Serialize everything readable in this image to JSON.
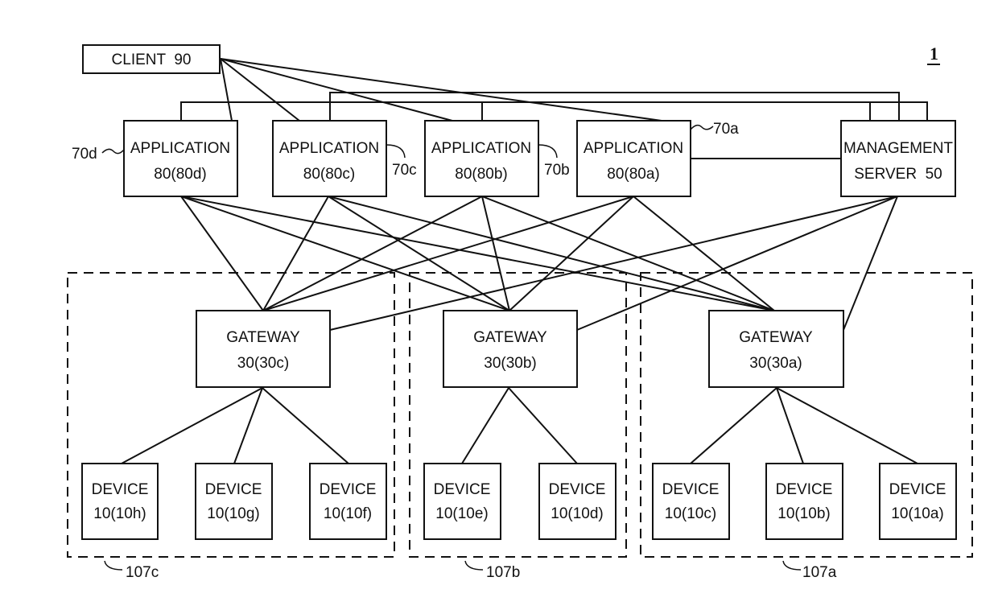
{
  "figure": {
    "number": "1"
  },
  "client": {
    "id": "client-90",
    "label": "CLIENT  90"
  },
  "applications": [
    {
      "id": "app-80d",
      "line1": "APPLICATION",
      "line2": "80(80d)",
      "ref": "70d"
    },
    {
      "id": "app-80c",
      "line1": "APPLICATION",
      "line2": "80(80c)",
      "ref": "70c"
    },
    {
      "id": "app-80b",
      "line1": "APPLICATION",
      "line2": "80(80b)",
      "ref": "70b"
    },
    {
      "id": "app-80a",
      "line1": "APPLICATION",
      "line2": "80(80a)",
      "ref": "70a"
    }
  ],
  "management_server": {
    "id": "mgmt-50",
    "line1": "MANAGEMENT",
    "line2": "SERVER  50"
  },
  "gateways": [
    {
      "id": "gw-30c",
      "line1": "GATEWAY",
      "line2": "30(30c)"
    },
    {
      "id": "gw-30b",
      "line1": "GATEWAY",
      "line2": "30(30b)"
    },
    {
      "id": "gw-30a",
      "line1": "GATEWAY",
      "line2": "30(30a)"
    }
  ],
  "devices": [
    {
      "id": "dev-10h",
      "line1": "DEVICE",
      "line2": "10(10h)",
      "gateway": "gw-30c"
    },
    {
      "id": "dev-10g",
      "line1": "DEVICE",
      "line2": "10(10g)",
      "gateway": "gw-30c"
    },
    {
      "id": "dev-10f",
      "line1": "DEVICE",
      "line2": "10(10f)",
      "gateway": "gw-30c"
    },
    {
      "id": "dev-10e",
      "line1": "DEVICE",
      "line2": "10(10e)",
      "gateway": "gw-30b"
    },
    {
      "id": "dev-10d",
      "line1": "DEVICE",
      "line2": "10(10d)",
      "gateway": "gw-30b"
    },
    {
      "id": "dev-10c",
      "line1": "DEVICE",
      "line2": "10(10c)",
      "gateway": "gw-30a"
    },
    {
      "id": "dev-10b",
      "line1": "DEVICE",
      "line2": "10(10b)",
      "gateway": "gw-30a"
    },
    {
      "id": "dev-10a",
      "line1": "DEVICE",
      "line2": "10(10a)",
      "gateway": "gw-30a"
    }
  ],
  "groups": [
    {
      "id": "group-107c",
      "ref": "107c"
    },
    {
      "id": "group-107b",
      "ref": "107b"
    },
    {
      "id": "group-107a",
      "ref": "107a"
    }
  ],
  "connections": {
    "client_to": [
      "app-80d",
      "app-80c",
      "app-80b",
      "app-80a"
    ],
    "app_to_gateway": [
      [
        "app-80d",
        "gw-30c"
      ],
      [
        "app-80d",
        "gw-30b"
      ],
      [
        "app-80d",
        "gw-30a"
      ],
      [
        "app-80c",
        "gw-30c"
      ],
      [
        "app-80c",
        "gw-30b"
      ],
      [
        "app-80c",
        "gw-30a"
      ],
      [
        "app-80b",
        "gw-30c"
      ],
      [
        "app-80b",
        "gw-30b"
      ],
      [
        "app-80b",
        "gw-30a"
      ],
      [
        "app-80a",
        "gw-30c"
      ],
      [
        "app-80a",
        "gw-30b"
      ],
      [
        "app-80a",
        "gw-30a"
      ]
    ],
    "management_to_gateway": [
      "gw-30c",
      "gw-30b",
      "gw-30a"
    ],
    "management_to_app": [
      "app-80a"
    ],
    "management_bus": [
      "app-80d",
      "app-80c",
      "app-80b"
    ]
  }
}
